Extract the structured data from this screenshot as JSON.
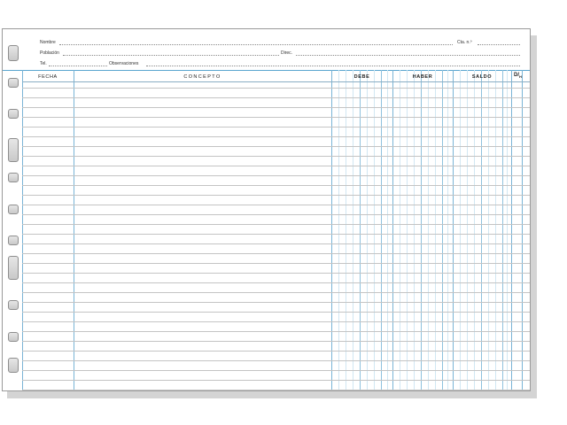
{
  "header": {
    "nombre_label": "Nombre",
    "cta_label": "Cta. n.º",
    "poblacion_label": "Población",
    "direc_label": "Direc.",
    "tel_label": "Tel.",
    "observaciones_label": "Observaciones"
  },
  "columns": {
    "fecha": "FECHA",
    "concepto": "CONCEPTO",
    "debe": "DEBE",
    "haber": "HABER",
    "saldo": "SALDO",
    "corner_mark_top": "D/",
    "corner_mark_sub": "H"
  },
  "colors": {
    "accent_blue": "#5aa6cf",
    "rule_gray": "#c4c4c4"
  }
}
